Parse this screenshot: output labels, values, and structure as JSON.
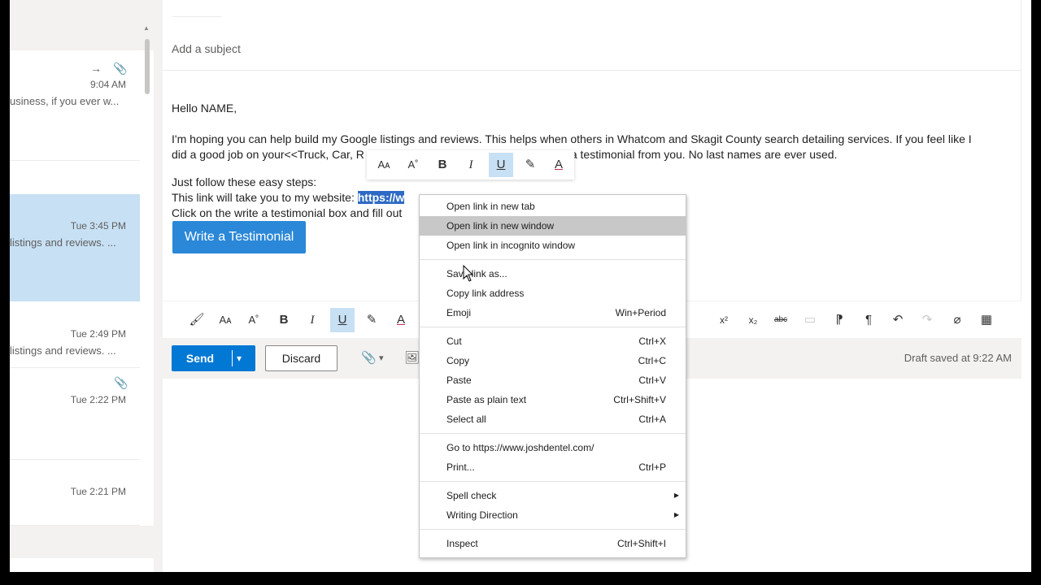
{
  "message_list": {
    "items": [
      {
        "time": "9:04 AM",
        "preview": "usiness, if you ever w...",
        "icons": [
          "forward-icon",
          "paperclip-icon"
        ]
      },
      {
        "time": "Tue 3:45 PM",
        "preview": "listings and reviews. ...",
        "selected": true
      },
      {
        "time": "Tue 2:49 PM",
        "preview": "listings and reviews. ..."
      },
      {
        "time": "Tue 2:22 PM",
        "preview": "",
        "icons": [
          "paperclip-icon"
        ]
      },
      {
        "time": "Tue 2:21 PM",
        "preview": ""
      }
    ]
  },
  "compose": {
    "subject_placeholder": "Add a subject",
    "greeting": "Hello NAME,",
    "para1_line1": "I'm hoping you can help build my Google listings and reviews.  This helps when others in Whatcom and Skagit County search detailing services. If you feel like I",
    "para1_line2_a": "did a good job on your<<Truck, Car, R",
    "para1_line2_b": "a testimonial from you.  No last names are ever used.",
    "steps_intro": "Just follow these easy steps:",
    "step1_prefix": "This link will take you to my website: ",
    "step1_link": "https://w",
    "step2": "Click on the write a testimonial box and fill out",
    "cta_label": "Write a Testimonial"
  },
  "actions": {
    "send_label": "Send",
    "discard_label": "Discard",
    "draft_status": "Draft saved at 9:22 AM"
  },
  "context_menu": {
    "groups": [
      [
        {
          "label": "Open link in new tab",
          "shortcut": ""
        },
        {
          "label": "Open link in new window",
          "shortcut": "",
          "hover": true
        },
        {
          "label": "Open link in incognito window",
          "shortcut": ""
        }
      ],
      [
        {
          "label": "Save link as...",
          "shortcut": ""
        },
        {
          "label": "Copy link address",
          "shortcut": ""
        },
        {
          "label": "Emoji",
          "shortcut": "Win+Period"
        }
      ],
      [
        {
          "label": "Cut",
          "shortcut": "Ctrl+X"
        },
        {
          "label": "Copy",
          "shortcut": "Ctrl+C"
        },
        {
          "label": "Paste",
          "shortcut": "Ctrl+V"
        },
        {
          "label": "Paste as plain text",
          "shortcut": "Ctrl+Shift+V"
        },
        {
          "label": "Select all",
          "shortcut": "Ctrl+A"
        }
      ],
      [
        {
          "label": "Go to https://www.joshdentel.com/",
          "shortcut": ""
        },
        {
          "label": "Print...",
          "shortcut": "Ctrl+P"
        }
      ],
      [
        {
          "label": "Spell check",
          "submenu": true
        },
        {
          "label": "Writing Direction",
          "submenu": true
        }
      ],
      [
        {
          "label": "Inspect",
          "shortcut": "Ctrl+Shift+I"
        }
      ]
    ]
  },
  "colors": {
    "accent": "#0078d4",
    "selected_row": "#c7e0f4",
    "cta": "#2b88d8",
    "selection_highlight": "#2d6ac4"
  }
}
